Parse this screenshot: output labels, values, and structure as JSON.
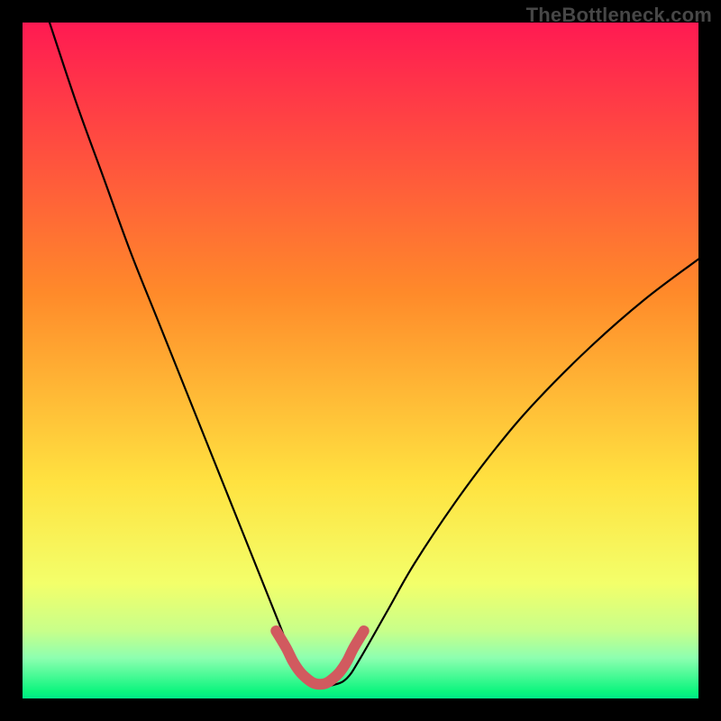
{
  "watermark": "TheBottleneck.com",
  "chart_data": {
    "type": "line",
    "title": "",
    "xlabel": "",
    "ylabel": "",
    "xlim": [
      0,
      100
    ],
    "ylim": [
      0,
      100
    ],
    "grid": false,
    "legend": false,
    "series": [
      {
        "name": "curve",
        "x": [
          4,
          8,
          12,
          16,
          20,
          24,
          28,
          32,
          36,
          38,
          40,
          42,
          44,
          46,
          48,
          50,
          54,
          58,
          64,
          70,
          76,
          84,
          92,
          100
        ],
        "y": [
          100,
          88,
          77,
          66,
          56,
          46,
          36,
          26,
          16,
          11,
          6,
          3,
          2,
          2,
          3,
          6,
          13,
          20,
          29,
          37,
          44,
          52,
          59,
          65
        ]
      }
    ],
    "highlight_segment": {
      "name": "trough-marker",
      "x": [
        37.5,
        39,
        40,
        41,
        42,
        43,
        44,
        45,
        46,
        47,
        48,
        49,
        50.5
      ],
      "y": [
        10,
        7.5,
        5.5,
        4,
        3,
        2.3,
        2.1,
        2.3,
        3,
        4,
        5.5,
        7.5,
        10
      ],
      "color": "#d15a5f",
      "width": 12
    },
    "background_gradient": {
      "top": "#ff1a52",
      "mid": "#ffe240",
      "bottom": "#0bf57e"
    }
  }
}
